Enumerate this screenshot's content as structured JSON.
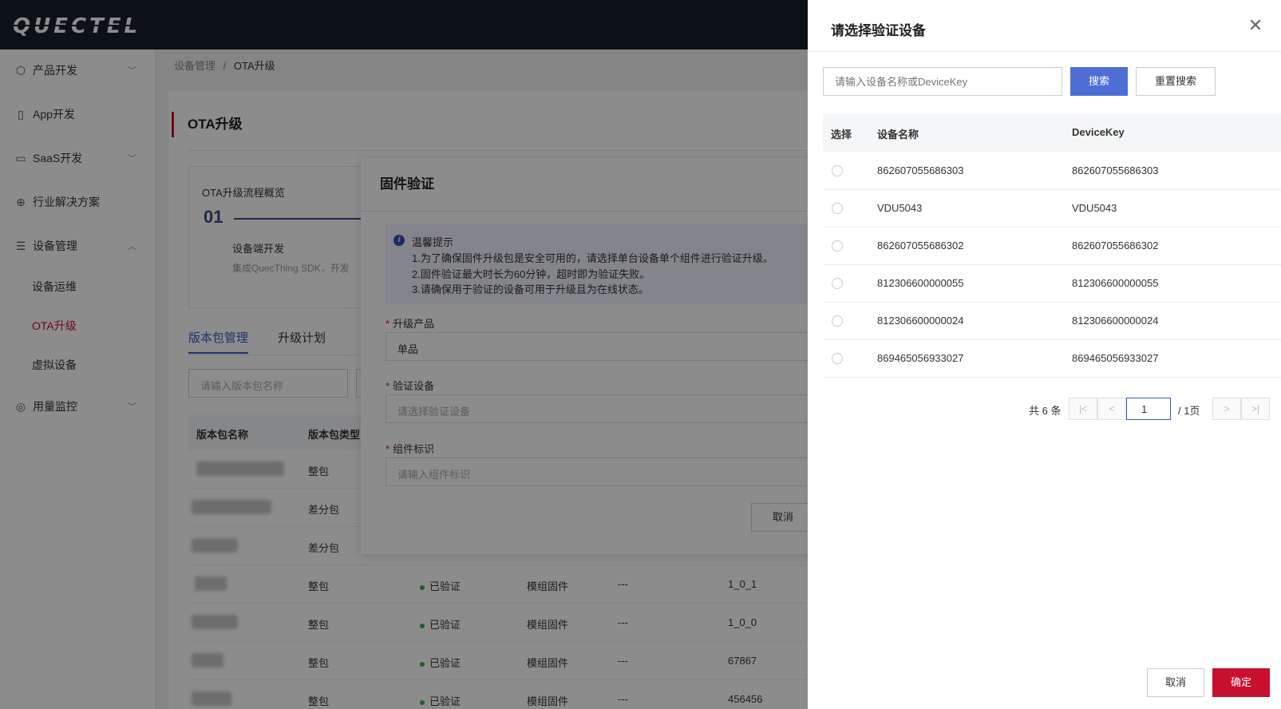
{
  "header": {
    "logo": "QUECTEL"
  },
  "sidebar": {
    "items": [
      {
        "label": "产品开发",
        "icon": "cube-icon"
      },
      {
        "label": "App开发",
        "icon": "phone-icon"
      },
      {
        "label": "SaaS开发",
        "icon": "monitor-icon"
      },
      {
        "label": "行业解决方案",
        "icon": "globe-icon"
      },
      {
        "label": "设备管理",
        "icon": "server-icon"
      },
      {
        "label": "设备运维"
      },
      {
        "label": "OTA升级"
      },
      {
        "label": "虚拟设备"
      },
      {
        "label": "用量监控",
        "icon": "pulse-icon"
      }
    ]
  },
  "breadcrumb": {
    "parent": "设备管理",
    "sep": "/",
    "current": "OTA升级"
  },
  "page": {
    "title": "OTA升级",
    "flow": {
      "title": "OTA升级流程概览",
      "step": "01",
      "step_title": "设备端开发",
      "step_desc": "集成QuecThing SDK，开发"
    },
    "tabs": [
      "版本包管理",
      "升级计划"
    ],
    "search_placeholder": "请输入版本包名称",
    "table": {
      "headers": [
        "版本包名称",
        "版本包类型"
      ],
      "rows": [
        {
          "type": "整包",
          "status": "",
          "component": "",
          "dash": "",
          "version": ""
        },
        {
          "type": "差分包",
          "status": "",
          "component": "",
          "dash": "",
          "version": ""
        },
        {
          "type": "差分包",
          "status": "",
          "component": "",
          "dash": "",
          "version": ""
        },
        {
          "type": "整包",
          "status": "已验证",
          "component": "模组固件",
          "dash": "---",
          "version": "1_0_1"
        },
        {
          "type": "整包",
          "status": "已验证",
          "component": "模组固件",
          "dash": "---",
          "version": "1_0_0"
        },
        {
          "type": "整包",
          "status": "已验证",
          "component": "模组固件",
          "dash": "---",
          "version": "67867"
        },
        {
          "type": "整包",
          "status": "已验证",
          "component": "模组固件",
          "dash": "---",
          "version": "456456"
        }
      ]
    }
  },
  "firmware_modal": {
    "title": "固件验证",
    "tip_title": "温馨提示",
    "tips": [
      "1.为了确保固件升级包是安全可用的，请选择单台设备单个组件进行验证升级。",
      "2.固件验证最大时长为60分钟，超时即为验证失败。",
      "3.请确保用于验证的设备可用于升级且为在线状态。"
    ],
    "product_label": "升级产品",
    "product_value": "单品",
    "device_label": "验证设备",
    "device_placeholder": "请选择验证设备",
    "component_label": "组件标识",
    "component_placeholder": "请输入组件标识",
    "cancel": "取消"
  },
  "drawer": {
    "title": "请选择验证设备",
    "close_icon": "close-icon",
    "search_placeholder": "请输入设备名称或DeviceKey",
    "search_button": "搜索",
    "reset_button": "重置搜索",
    "headers": {
      "select": "选择",
      "name": "设备名称",
      "key": "DeviceKey"
    },
    "rows": [
      {
        "name": "862607055686303",
        "key": "862607055686303"
      },
      {
        "name": "VDU5043",
        "key": "VDU5043"
      },
      {
        "name": "862607055686302",
        "key": "862607055686302"
      },
      {
        "name": "812306600000055",
        "key": "812306600000055"
      },
      {
        "name": "812306600000024",
        "key": "812306600000024"
      },
      {
        "name": "869465056933027",
        "key": "869465056933027"
      }
    ],
    "pagination": {
      "total": "共 6 条",
      "page": "1",
      "pages": "/ 1页"
    },
    "cancel": "取消",
    "confirm": "确定"
  },
  "colors": {
    "brand_red": "#c8102e",
    "primary_blue": "#4e6ed6",
    "header_bg": "#16202d",
    "status_green": "#2bb24c"
  }
}
